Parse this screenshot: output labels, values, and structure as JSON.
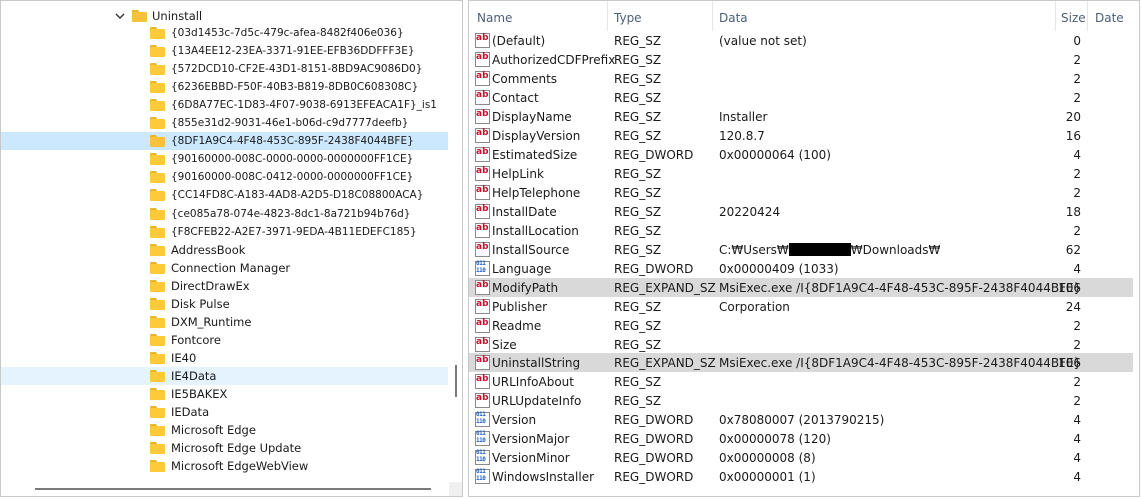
{
  "tree": {
    "parent": "Uninstall",
    "children": [
      "{03d1453c-7d5c-479c-afea-8482f406e036}",
      "{13A4EE12-23EA-3371-91EE-EFB36DDFFF3E}",
      "{572DCD10-CF2E-43D1-8151-8BD9AC9086D0}",
      "{6236EBBD-F50F-40B3-B819-8DB0C608308C}",
      "{6D8A77EC-1D83-4F07-9038-6913EFEACA1F}_is1",
      "{855e31d2-9031-46e1-b06d-c9d7777deefb}",
      "{8DF1A9C4-4F48-453C-895F-2438F4044BFE}",
      "{90160000-008C-0000-0000-0000000FF1CE}",
      "{90160000-008C-0412-0000-0000000FF1CE}",
      "{CC14FD8C-A183-4AD8-A2D5-D18C08800ACA}",
      "{ce085a78-074e-4823-8dc1-8a721b94b76d}",
      "{F8CFEB22-A2E7-3971-9EDA-4B11EDEFC185}",
      "AddressBook",
      "Connection Manager",
      "DirectDrawEx",
      "Disk Pulse",
      "DXM_Runtime",
      "Fontcore",
      "IE40",
      "IE4Data",
      "IE5BAKEX",
      "IEData",
      "Microsoft Edge",
      "Microsoft Edge Update",
      "Microsoft EdgeWebView"
    ]
  },
  "list": {
    "headers": {
      "name": "Name",
      "type": "Type",
      "data": "Data",
      "size": "Size",
      "date": "Date"
    },
    "rows": [
      {
        "icon": "string-value-icon",
        "name": "(Default)",
        "type": "REG_SZ",
        "data": "(value not set)",
        "size": "0"
      },
      {
        "icon": "string-value-icon",
        "name": "AuthorizedCDFPrefix",
        "type": "REG_SZ",
        "data": "",
        "size": "2"
      },
      {
        "icon": "string-value-icon",
        "name": "Comments",
        "type": "REG_SZ",
        "data": "",
        "size": "2"
      },
      {
        "icon": "string-value-icon",
        "name": "Contact",
        "type": "REG_SZ",
        "data": "",
        "size": "2"
      },
      {
        "icon": "string-value-icon",
        "name": "DisplayName",
        "type": "REG_SZ",
        "data": "Installer",
        "size": "20"
      },
      {
        "icon": "string-value-icon",
        "name": "DisplayVersion",
        "type": "REG_SZ",
        "data": "120.8.7",
        "size": "16"
      },
      {
        "icon": "string-value-icon",
        "name": "EstimatedSize",
        "type": "REG_DWORD",
        "data": "0x00000064 (100)",
        "size": "4"
      },
      {
        "icon": "string-value-icon",
        "name": "HelpLink",
        "type": "REG_SZ",
        "data": "",
        "size": "2"
      },
      {
        "icon": "string-value-icon",
        "name": "HelpTelephone",
        "type": "REG_SZ",
        "data": "",
        "size": "2"
      },
      {
        "icon": "string-value-icon",
        "name": "InstallDate",
        "type": "REG_SZ",
        "data": "20220424",
        "size": "18"
      },
      {
        "icon": "string-value-icon",
        "name": "InstallLocation",
        "type": "REG_SZ",
        "data": "",
        "size": "2"
      },
      {
        "icon": "string-value-icon",
        "name": "InstallSource",
        "type": "REG_SZ",
        "data": "C:₩Users₩",
        "data_after": "₩Downloads₩",
        "redacted": true,
        "size": "62"
      },
      {
        "icon": "dword-value-icon",
        "name": "Language",
        "type": "REG_DWORD",
        "data": "0x00000409 (1033)",
        "size": "4"
      },
      {
        "icon": "string-value-icon",
        "name": "ModifyPath",
        "type": "REG_EXPAND_SZ",
        "data": "MsiExec.exe /I{8DF1A9C4-4F48-453C-895F-2438F4044BFE}",
        "size": "106"
      },
      {
        "icon": "string-value-icon",
        "name": "Publisher",
        "type": "REG_SZ",
        "data": "Corporation",
        "size": "24"
      },
      {
        "icon": "string-value-icon",
        "name": "Readme",
        "type": "REG_SZ",
        "data": "",
        "size": "2"
      },
      {
        "icon": "string-value-icon",
        "name": "Size",
        "type": "REG_SZ",
        "data": "",
        "size": "2"
      },
      {
        "icon": "string-value-icon",
        "name": "UninstallString",
        "type": "REG_EXPAND_SZ",
        "data": "MsiExec.exe /I{8DF1A9C4-4F48-453C-895F-2438F4044BFE}",
        "size": "106"
      },
      {
        "icon": "string-value-icon",
        "name": "URLInfoAbout",
        "type": "REG_SZ",
        "data": "",
        "size": "2"
      },
      {
        "icon": "string-value-icon",
        "name": "URLUpdateInfo",
        "type": "REG_SZ",
        "data": "",
        "size": "2"
      },
      {
        "icon": "dword-value-icon",
        "name": "Version",
        "type": "REG_DWORD",
        "data": "0x78080007 (2013790215)",
        "size": "4"
      },
      {
        "icon": "dword-value-icon",
        "name": "VersionMajor",
        "type": "REG_DWORD",
        "data": "0x00000078 (120)",
        "size": "4"
      },
      {
        "icon": "dword-value-icon",
        "name": "VersionMinor",
        "type": "REG_DWORD",
        "data": "0x00000008 (8)",
        "size": "4"
      },
      {
        "icon": "dword-value-icon",
        "name": "WindowsInstaller",
        "type": "REG_DWORD",
        "data": "0x00000001 (1)",
        "size": "4"
      }
    ]
  },
  "colors": {
    "tree_selected": "#cce8ff",
    "tree_hover": "#e5f3ff",
    "list_selected": "#d9d9d9",
    "folder": "#ffca3a",
    "header_text": "#4c607a"
  }
}
